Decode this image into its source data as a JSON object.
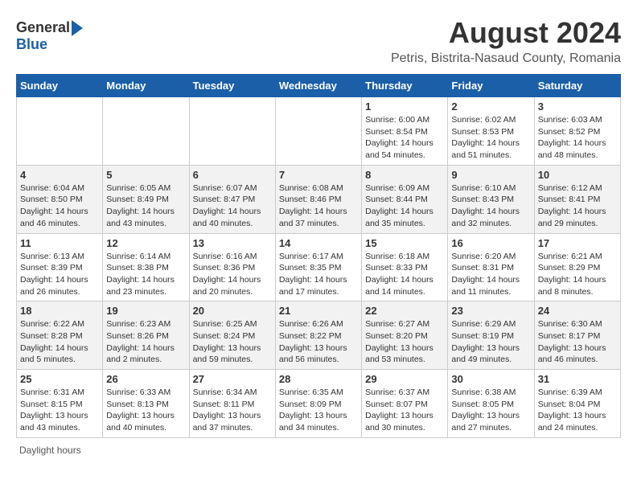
{
  "logo": {
    "general": "General",
    "blue": "Blue"
  },
  "title": "August 2024",
  "subtitle": "Petris, Bistrita-Nasaud County, Romania",
  "days": [
    "Sunday",
    "Monday",
    "Tuesday",
    "Wednesday",
    "Thursday",
    "Friday",
    "Saturday"
  ],
  "weeks": [
    [
      {
        "day": "",
        "info": ""
      },
      {
        "day": "",
        "info": ""
      },
      {
        "day": "",
        "info": ""
      },
      {
        "day": "",
        "info": ""
      },
      {
        "day": "1",
        "info": "Sunrise: 6:00 AM\nSunset: 8:54 PM\nDaylight: 14 hours\nand 54 minutes."
      },
      {
        "day": "2",
        "info": "Sunrise: 6:02 AM\nSunset: 8:53 PM\nDaylight: 14 hours\nand 51 minutes."
      },
      {
        "day": "3",
        "info": "Sunrise: 6:03 AM\nSunset: 8:52 PM\nDaylight: 14 hours\nand 48 minutes."
      }
    ],
    [
      {
        "day": "4",
        "info": "Sunrise: 6:04 AM\nSunset: 8:50 PM\nDaylight: 14 hours\nand 46 minutes."
      },
      {
        "day": "5",
        "info": "Sunrise: 6:05 AM\nSunset: 8:49 PM\nDaylight: 14 hours\nand 43 minutes."
      },
      {
        "day": "6",
        "info": "Sunrise: 6:07 AM\nSunset: 8:47 PM\nDaylight: 14 hours\nand 40 minutes."
      },
      {
        "day": "7",
        "info": "Sunrise: 6:08 AM\nSunset: 8:46 PM\nDaylight: 14 hours\nand 37 minutes."
      },
      {
        "day": "8",
        "info": "Sunrise: 6:09 AM\nSunset: 8:44 PM\nDaylight: 14 hours\nand 35 minutes."
      },
      {
        "day": "9",
        "info": "Sunrise: 6:10 AM\nSunset: 8:43 PM\nDaylight: 14 hours\nand 32 minutes."
      },
      {
        "day": "10",
        "info": "Sunrise: 6:12 AM\nSunset: 8:41 PM\nDaylight: 14 hours\nand 29 minutes."
      }
    ],
    [
      {
        "day": "11",
        "info": "Sunrise: 6:13 AM\nSunset: 8:39 PM\nDaylight: 14 hours\nand 26 minutes."
      },
      {
        "day": "12",
        "info": "Sunrise: 6:14 AM\nSunset: 8:38 PM\nDaylight: 14 hours\nand 23 minutes."
      },
      {
        "day": "13",
        "info": "Sunrise: 6:16 AM\nSunset: 8:36 PM\nDaylight: 14 hours\nand 20 minutes."
      },
      {
        "day": "14",
        "info": "Sunrise: 6:17 AM\nSunset: 8:35 PM\nDaylight: 14 hours\nand 17 minutes."
      },
      {
        "day": "15",
        "info": "Sunrise: 6:18 AM\nSunset: 8:33 PM\nDaylight: 14 hours\nand 14 minutes."
      },
      {
        "day": "16",
        "info": "Sunrise: 6:20 AM\nSunset: 8:31 PM\nDaylight: 14 hours\nand 11 minutes."
      },
      {
        "day": "17",
        "info": "Sunrise: 6:21 AM\nSunset: 8:29 PM\nDaylight: 14 hours\nand 8 minutes."
      }
    ],
    [
      {
        "day": "18",
        "info": "Sunrise: 6:22 AM\nSunset: 8:28 PM\nDaylight: 14 hours\nand 5 minutes."
      },
      {
        "day": "19",
        "info": "Sunrise: 6:23 AM\nSunset: 8:26 PM\nDaylight: 14 hours\nand 2 minutes."
      },
      {
        "day": "20",
        "info": "Sunrise: 6:25 AM\nSunset: 8:24 PM\nDaylight: 13 hours\nand 59 minutes."
      },
      {
        "day": "21",
        "info": "Sunrise: 6:26 AM\nSunset: 8:22 PM\nDaylight: 13 hours\nand 56 minutes."
      },
      {
        "day": "22",
        "info": "Sunrise: 6:27 AM\nSunset: 8:20 PM\nDaylight: 13 hours\nand 53 minutes."
      },
      {
        "day": "23",
        "info": "Sunrise: 6:29 AM\nSunset: 8:19 PM\nDaylight: 13 hours\nand 49 minutes."
      },
      {
        "day": "24",
        "info": "Sunrise: 6:30 AM\nSunset: 8:17 PM\nDaylight: 13 hours\nand 46 minutes."
      }
    ],
    [
      {
        "day": "25",
        "info": "Sunrise: 6:31 AM\nSunset: 8:15 PM\nDaylight: 13 hours\nand 43 minutes."
      },
      {
        "day": "26",
        "info": "Sunrise: 6:33 AM\nSunset: 8:13 PM\nDaylight: 13 hours\nand 40 minutes."
      },
      {
        "day": "27",
        "info": "Sunrise: 6:34 AM\nSunset: 8:11 PM\nDaylight: 13 hours\nand 37 minutes."
      },
      {
        "day": "28",
        "info": "Sunrise: 6:35 AM\nSunset: 8:09 PM\nDaylight: 13 hours\nand 34 minutes."
      },
      {
        "day": "29",
        "info": "Sunrise: 6:37 AM\nSunset: 8:07 PM\nDaylight: 13 hours\nand 30 minutes."
      },
      {
        "day": "30",
        "info": "Sunrise: 6:38 AM\nSunset: 8:05 PM\nDaylight: 13 hours\nand 27 minutes."
      },
      {
        "day": "31",
        "info": "Sunrise: 6:39 AM\nSunset: 8:04 PM\nDaylight: 13 hours\nand 24 minutes."
      }
    ]
  ],
  "footer": "Daylight hours"
}
